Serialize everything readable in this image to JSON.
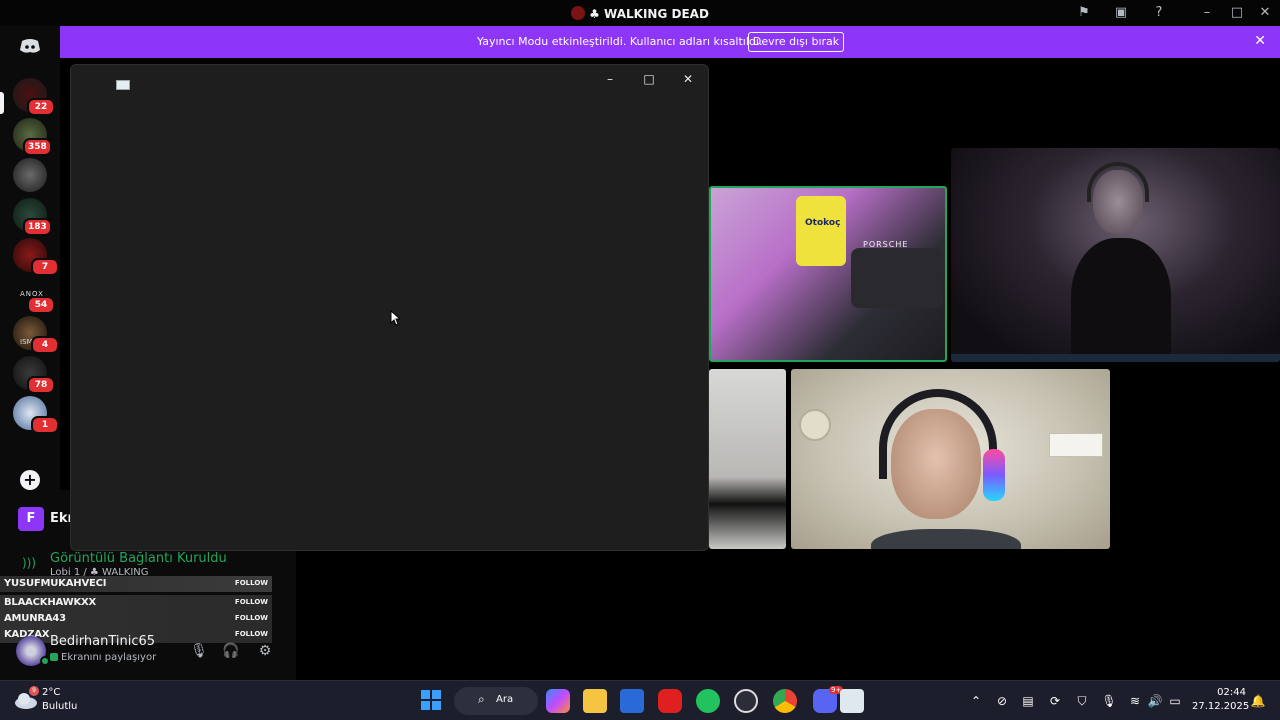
{
  "window": {
    "title": "♣ WALKING DEAD"
  },
  "banner": {
    "message": "Yayıncı Modu etkinleştirildi. Kullanıcı adları kısaltıldı.",
    "button_label": "Devre dışı bırak",
    "close_label": "✕"
  },
  "rail": {
    "badges": [
      "22",
      "358",
      "183",
      "7",
      "54",
      "4",
      "78",
      "1"
    ],
    "server_texts": [
      "ANOX",
      "ISM"
    ]
  },
  "channel": {
    "f_label": "F",
    "f_text": "Ekr",
    "voice_status": "Görüntülü Bağlantı Kuruldu",
    "voice_sub": "Lobi 1 / ♣ WALKING"
  },
  "follow_overlay": [
    {
      "name": "YUSUFMUKAHVECI",
      "tag": "FOLLOW"
    },
    {
      "name": "BLAACKHAWKXX",
      "tag": "FOLLOW"
    },
    {
      "name": "AMUNRA43",
      "tag": "FOLLOW"
    },
    {
      "name": "KADZAX",
      "tag": "FOLLOW"
    }
  ],
  "user": {
    "name": "BedirhanTinic65",
    "status": "Ekranını paylaşıyor"
  },
  "video": {
    "jersey_text": "Otokoç",
    "pillow_text": "PORSCHE"
  },
  "taskbar": {
    "weather_temp": "2°C",
    "weather_desc": "Bulutlu",
    "weather_badge": "9",
    "search_label": "Ara",
    "time": "02:44",
    "date": "27.12.2025",
    "discord_badge": "9+"
  },
  "colors": {
    "banner": "#8d36f7",
    "speaking_border": "#23a55a",
    "badge": "#e12f33"
  }
}
